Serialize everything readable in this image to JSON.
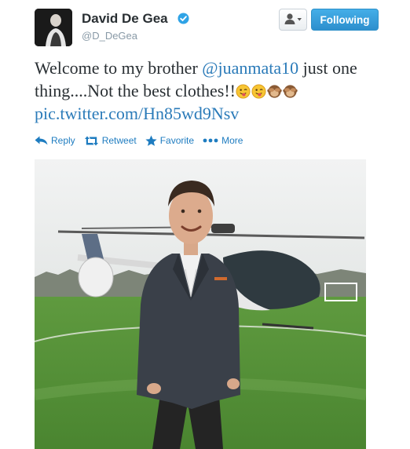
{
  "user": {
    "display_name": "David De Gea",
    "screen_name": "@D_DeGea"
  },
  "header": {
    "follow_label": "Following"
  },
  "tweet": {
    "text_part1": "Welcome to my brother ",
    "mention": "@juanmata10",
    "text_part2": " just one thing....Not the best clothes!!",
    "pic_link": "pic.twitter.com/Hn85wd9Nsv"
  },
  "actions": {
    "reply": "Reply",
    "retweet": "Retweet",
    "favorite": "Favorite",
    "more": "More"
  },
  "colors": {
    "link": "#2b7bb9",
    "action": "#1e7cc0",
    "follow_button": "#2d8fce",
    "verified": "#2fa3e6"
  }
}
